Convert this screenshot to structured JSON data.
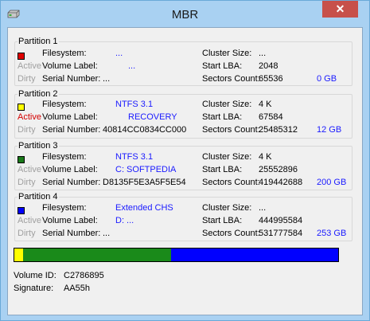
{
  "window": {
    "title": "MBR",
    "close_symbol": "✕"
  },
  "colors": {
    "partition1": "#e00000",
    "partition2": "#ffff00",
    "partition3": "#1a7a1a",
    "partition4": "#0000ff",
    "bar_yellow": "#ffff00",
    "bar_green": "#1a8a1a",
    "bar_blue": "#0000ff"
  },
  "labels": {
    "filesystem": "Filesystem:",
    "volume_label": "Volume Label:",
    "serial_number": "Serial Number:",
    "cluster_size": "Cluster Size:",
    "start_lba": "Start LBA:",
    "sectors_count": "Sectors Count:",
    "active": "Active",
    "dirty": "Dirty"
  },
  "partitions": [
    {
      "title": "Partition 1",
      "active": false,
      "filesystem": "...",
      "volume_label": "...",
      "serial_number": "...",
      "cluster_size": "...",
      "start_lba": "2048",
      "sectors_count": "65536",
      "size": "0 GB"
    },
    {
      "title": "Partition 2",
      "active": true,
      "filesystem": "NTFS 3.1",
      "volume_label": "RECOVERY",
      "serial_number": "40814CC0834CC000",
      "cluster_size": "4 K",
      "start_lba": "67584",
      "sectors_count": "25485312",
      "size": "12 GB"
    },
    {
      "title": "Partition 3",
      "active": false,
      "filesystem": "NTFS 3.1",
      "volume_label": "C:  SOFTPEDIA",
      "serial_number": "D8135F5E3A5F5E54",
      "cluster_size": "4 K",
      "start_lba": "25552896",
      "sectors_count": "419442688",
      "size": "200 GB"
    },
    {
      "title": "Partition 4",
      "active": false,
      "filesystem": "Extended CHS",
      "volume_label": "D:  ...",
      "serial_number": "...",
      "cluster_size": "...",
      "start_lba": "444995584",
      "sectors_count": "531777584",
      "size": "253 GB"
    }
  ],
  "usage_bar": {
    "yellow_fraction": 0.028,
    "green_fraction": 0.457,
    "blue_fraction": 0.515
  },
  "footer": {
    "volume_id_label": "Volume ID:",
    "volume_id": "C2786895",
    "signature_label": "Signature:",
    "signature": "AA55h"
  }
}
